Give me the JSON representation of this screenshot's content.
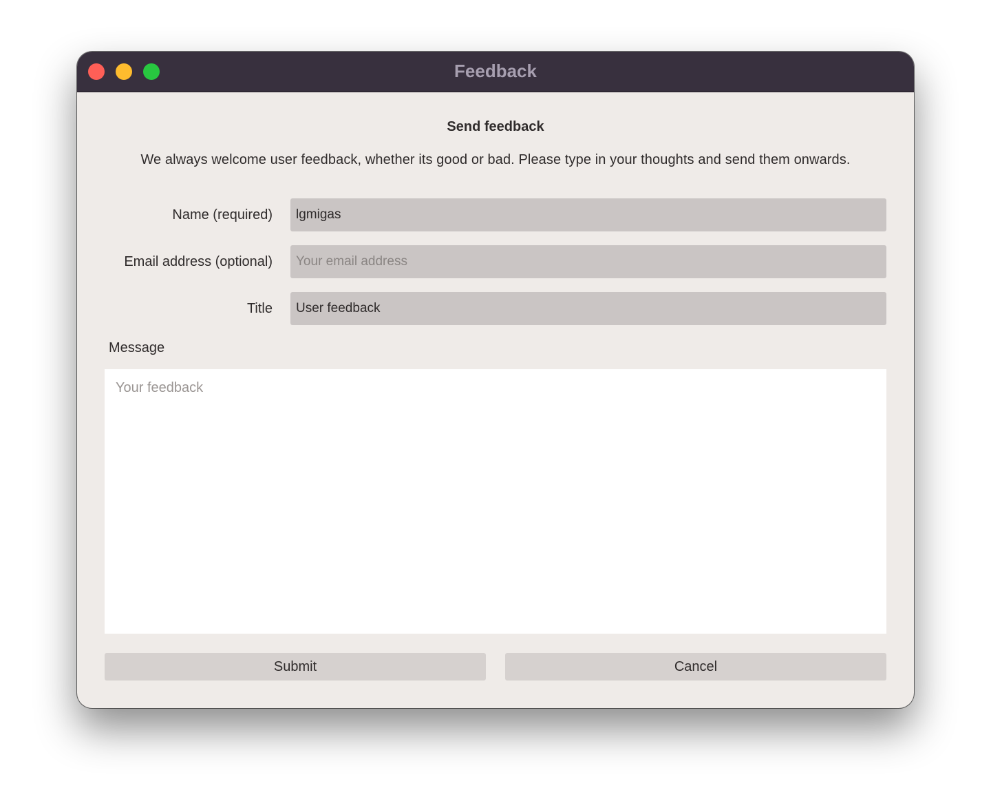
{
  "window": {
    "title": "Feedback"
  },
  "form": {
    "heading": "Send feedback",
    "intro": "We always welcome user feedback, whether its good or bad. Please type in your thoughts and send them onwards.",
    "name": {
      "label": "Name (required)",
      "value": "lgmigas",
      "placeholder": ""
    },
    "email": {
      "label": "Email address (optional)",
      "value": "",
      "placeholder": "Your email address"
    },
    "title": {
      "label": "Title",
      "value": "User feedback",
      "placeholder": ""
    },
    "message": {
      "label": "Message",
      "value": "",
      "placeholder": "Your feedback"
    }
  },
  "buttons": {
    "submit": "Submit",
    "cancel": "Cancel"
  },
  "colors": {
    "titlebar": "#38303e",
    "window_bg": "#efebe8",
    "input_bg": "#cac5c4",
    "button_bg": "#d6d1cf"
  }
}
